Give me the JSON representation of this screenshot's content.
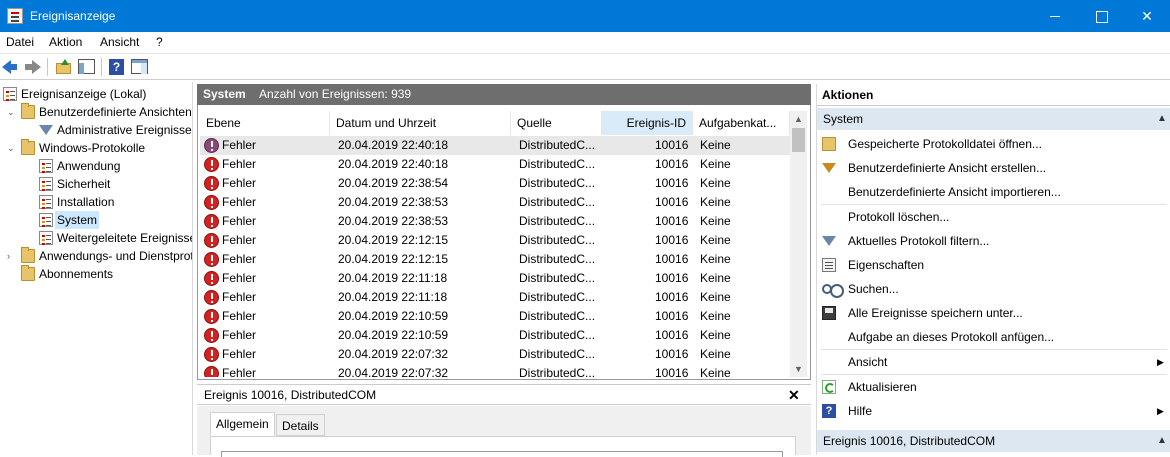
{
  "window": {
    "title": "Ereignisanzeige",
    "minimize": "–",
    "maximize": "☐",
    "close": "✕"
  },
  "menu": [
    "Datei",
    "Aktion",
    "Ansicht",
    "?"
  ],
  "toolbar": {
    "icons": [
      "back-arrow-icon",
      "forward-arrow-icon",
      "folder-up-icon",
      "show-hide-tree-icon",
      "help-icon",
      "show-hide-actions-icon"
    ],
    "help_glyph": "?"
  },
  "tree": {
    "root": "Ereignisanzeige (Lokal)",
    "custom_views": "Benutzerdefinierte Ansichten",
    "admin_events": "Administrative Ereignisse",
    "windows_logs": "Windows-Protokolle",
    "application": "Anwendung",
    "security": "Sicherheit",
    "setup": "Installation",
    "system": "System",
    "forwarded": "Weitergeleitete Ereignisse",
    "app_service_logs": "Anwendungs- und Dienstprotokolle",
    "subscriptions": "Abonnements",
    "expand_open": "⌄",
    "expand_closed": "›"
  },
  "center": {
    "log_name": "System",
    "event_count": "Anzahl von Ereignissen: 939",
    "columns": [
      "Ebene",
      "Datum und Uhrzeit",
      "Quelle",
      "Ereignis-ID",
      "Aufgabenkat..."
    ],
    "rows": [
      {
        "level": "Fehler",
        "datetime": "20.04.2019 22:40:18",
        "source": "DistributedC...",
        "id": "10016",
        "task": "Keine"
      },
      {
        "level": "Fehler",
        "datetime": "20.04.2019 22:40:18",
        "source": "DistributedC...",
        "id": "10016",
        "task": "Keine"
      },
      {
        "level": "Fehler",
        "datetime": "20.04.2019 22:38:54",
        "source": "DistributedC...",
        "id": "10016",
        "task": "Keine"
      },
      {
        "level": "Fehler",
        "datetime": "20.04.2019 22:38:53",
        "source": "DistributedC...",
        "id": "10016",
        "task": "Keine"
      },
      {
        "level": "Fehler",
        "datetime": "20.04.2019 22:38:53",
        "source": "DistributedC...",
        "id": "10016",
        "task": "Keine"
      },
      {
        "level": "Fehler",
        "datetime": "20.04.2019 22:12:15",
        "source": "DistributedC...",
        "id": "10016",
        "task": "Keine"
      },
      {
        "level": "Fehler",
        "datetime": "20.04.2019 22:12:15",
        "source": "DistributedC...",
        "id": "10016",
        "task": "Keine"
      },
      {
        "level": "Fehler",
        "datetime": "20.04.2019 22:11:18",
        "source": "DistributedC...",
        "id": "10016",
        "task": "Keine"
      },
      {
        "level": "Fehler",
        "datetime": "20.04.2019 22:11:18",
        "source": "DistributedC...",
        "id": "10016",
        "task": "Keine"
      },
      {
        "level": "Fehler",
        "datetime": "20.04.2019 22:10:59",
        "source": "DistributedC...",
        "id": "10016",
        "task": "Keine"
      },
      {
        "level": "Fehler",
        "datetime": "20.04.2019 22:10:59",
        "source": "DistributedC...",
        "id": "10016",
        "task": "Keine"
      },
      {
        "level": "Fehler",
        "datetime": "20.04.2019 22:07:32",
        "source": "DistributedC...",
        "id": "10016",
        "task": "Keine"
      },
      {
        "level": "Fehler",
        "datetime": "20.04.2019 22:07:32",
        "source": "DistributedC...",
        "id": "10016",
        "task": "Keine"
      }
    ],
    "scroll_up": "▲",
    "scroll_down": "▼"
  },
  "detail": {
    "title": "Ereignis 10016, DistributedCOM",
    "close": "✕",
    "tabs": [
      "Allgemein",
      "Details"
    ]
  },
  "actions": {
    "title": "Aktionen",
    "section1": "System",
    "section1_caret": "▲",
    "items": [
      "Gespeicherte Protokolldatei öffnen...",
      "Benutzerdefinierte Ansicht erstellen...",
      "Benutzerdefinierte Ansicht importieren...",
      "Protokoll löschen...",
      "Aktuelles Protokoll filtern...",
      "Eigenschaften",
      "Suchen...",
      "Alle Ereignisse speichern unter...",
      "Aufgabe an dieses Protokoll anfügen...",
      "Ansicht",
      "Aktualisieren",
      "Hilfe"
    ],
    "submenu_arrow": "▶",
    "help_glyph": "?",
    "section2": "Ereignis 10016, DistributedCOM",
    "section2_caret": "▲"
  }
}
